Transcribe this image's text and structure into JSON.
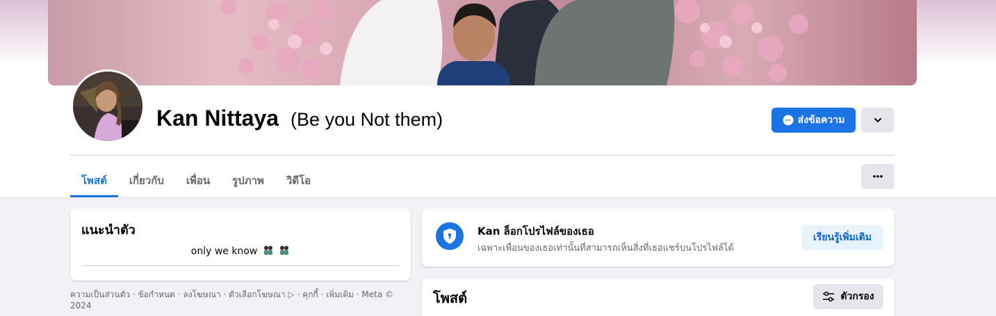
{
  "profile": {
    "name": "Kan Nittaya",
    "alternate_name": "(Be you Not them)"
  },
  "actions": {
    "message_label": "ส่งข้อความ"
  },
  "tabs": [
    {
      "label": "โพสต์",
      "active": true
    },
    {
      "label": "เกี่ยวกับ",
      "active": false
    },
    {
      "label": "เพื่อน",
      "active": false
    },
    {
      "label": "รูปภาพ",
      "active": false
    },
    {
      "label": "วิดีโอ",
      "active": false
    }
  ],
  "intro": {
    "title": "แนะนำตัว",
    "bio": "only we know"
  },
  "lock_notice": {
    "title": "Kan ล็อกโปรไฟล์ของเธอ",
    "description": "เฉพาะเพื่อนของเธอเท่านั้นที่สามารถเห็นสิ่งที่เธอแชร์บนโปรไฟล์ได้",
    "learn_more_label": "เรียนรู้เพิ่มเติม"
  },
  "posts": {
    "title": "โพสต์",
    "filter_label": "ตัวกรอง"
  },
  "footer": {
    "text": "ความเป็นส่วนตัว · ข้อกำหนด · ลงโฆษณา · ตัวเลือกโฆษณา ▷ · คุกกี้ · เพิ่มเติม · Meta © 2024"
  },
  "colors": {
    "accent": "#1b74e4",
    "secondary_button": "#e4e6eb",
    "learn_more_bg": "#e7f3ff",
    "page_bg": "#f0f2f5"
  },
  "icons": {
    "message": "messenger-icon",
    "dropdown": "chevron-down-icon",
    "more": "more-horizontal-icon",
    "lock": "shield-lock-icon",
    "filter": "filter-sliders-icon"
  }
}
